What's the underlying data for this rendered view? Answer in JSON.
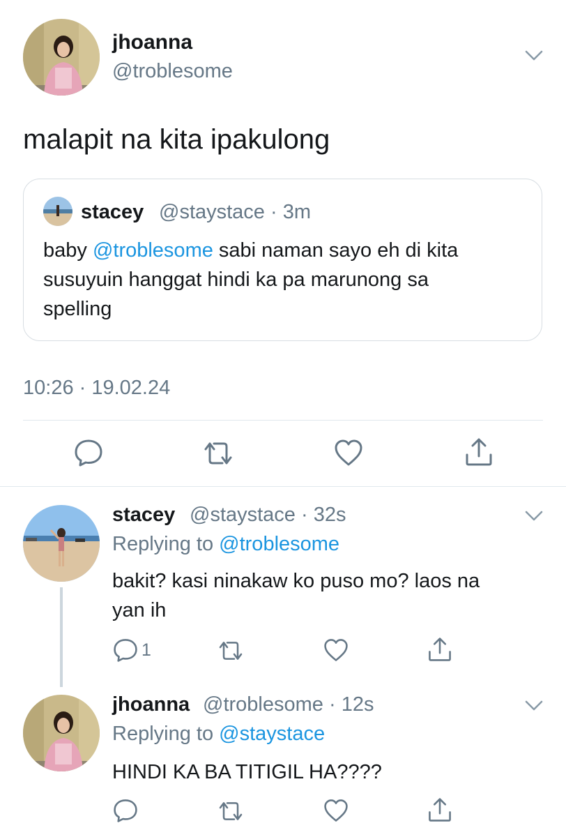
{
  "main_tweet": {
    "display_name": "jhoanna",
    "handle": "@troblesome",
    "text": "malapit na kita ipakulong",
    "timestamp": "10:26 · 19.02.24",
    "quoted": {
      "display_name": "stacey",
      "handle": "@staystace",
      "separator": "·",
      "time": "3m",
      "text_prefix": "baby ",
      "mention": "@troblesome",
      "text_line1_rest": " sabi naman sayo eh di kita",
      "text_line2": "susuyuin hanggat hindi ka pa marunong sa",
      "text_line3": "spelling"
    }
  },
  "replies": [
    {
      "display_name": "stacey",
      "handle": "@staystace",
      "separator": "·",
      "time": "32s",
      "replying_label": "Replying to ",
      "replying_to": "@troblesome",
      "text_line1": "bakit? kasi ninakaw ko puso mo? laos na",
      "text_line2": "yan ih",
      "reply_count": "1"
    },
    {
      "display_name": "jhoanna",
      "handle": "@troblesome",
      "separator": "·",
      "time": "12s",
      "replying_label": "Replying to ",
      "replying_to": "@staystace",
      "text_line1": "HINDI KA BA TITIGIL HA????"
    }
  ],
  "icons": {
    "reply": "reply-icon",
    "retweet": "retweet-icon",
    "like": "heart-icon",
    "share": "share-icon",
    "more": "chevron-down-icon"
  },
  "colors": {
    "link": "#1b95e0",
    "muted": "#657786",
    "divider": "#e1e8ed"
  }
}
